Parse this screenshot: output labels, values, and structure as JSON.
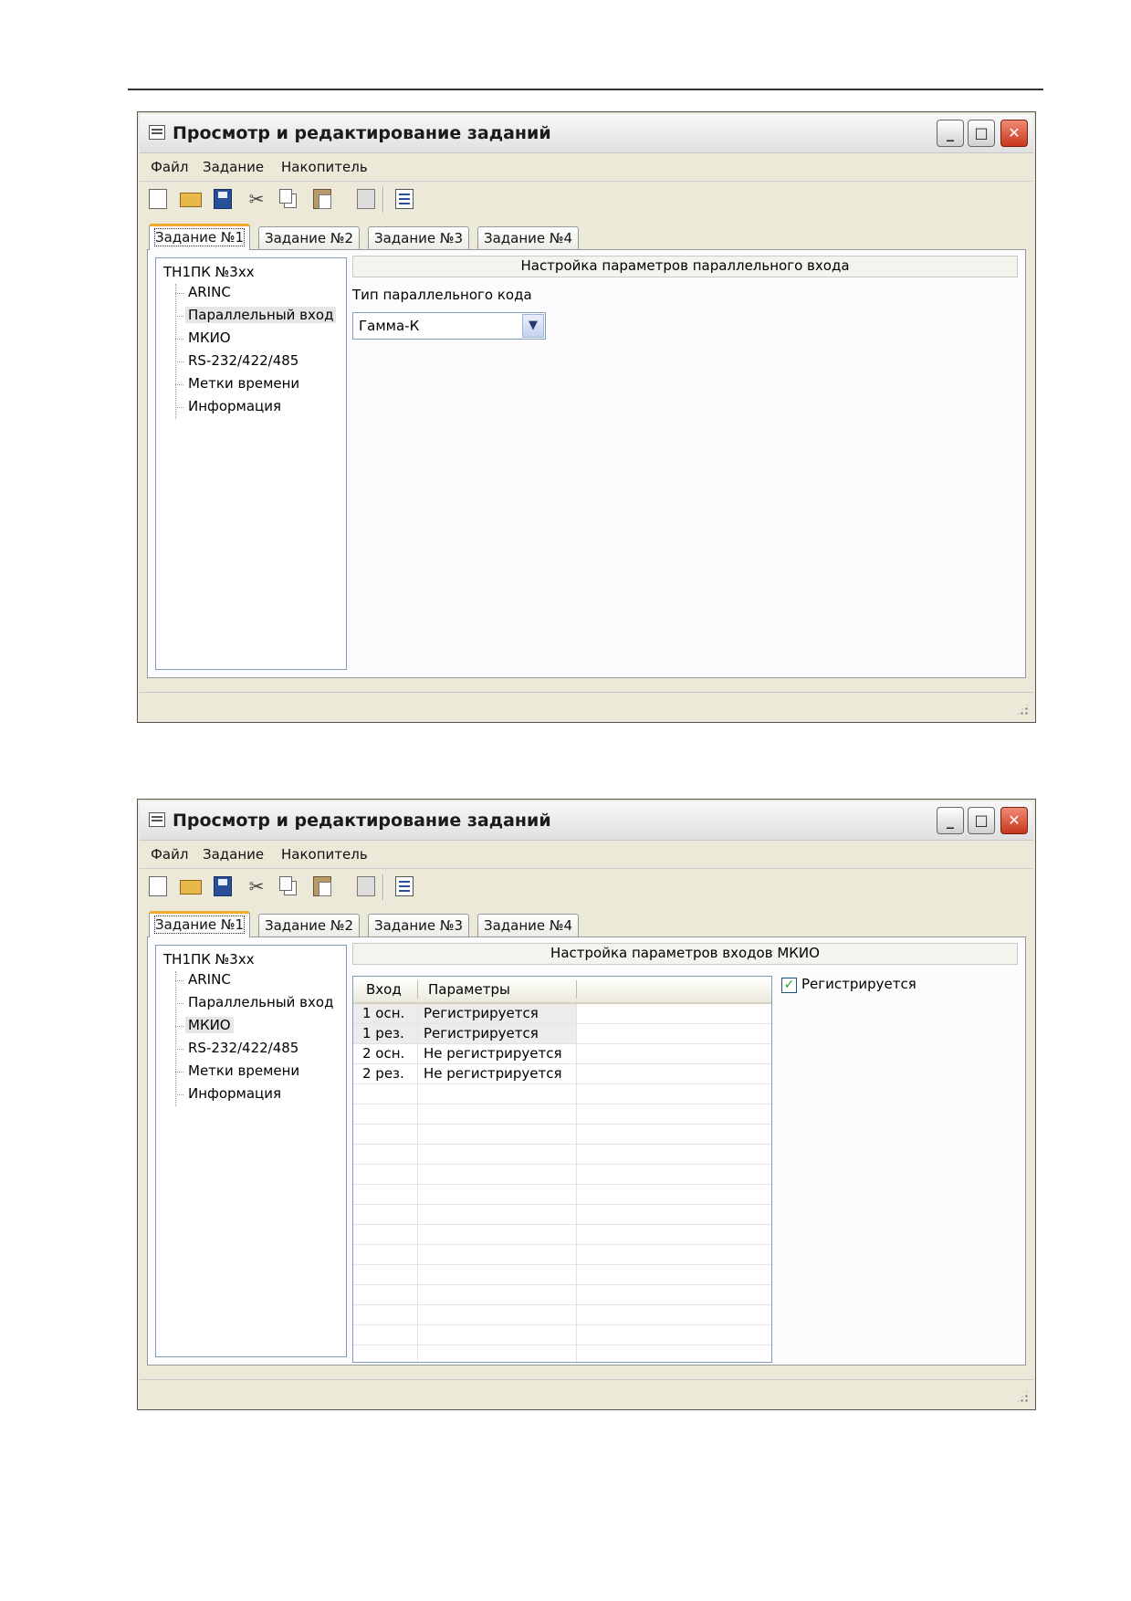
{
  "windows": [
    {
      "title": "Просмотр и редактирование заданий",
      "window_buttons": {
        "minimize": "_",
        "maximize": "□",
        "close": "✕"
      },
      "menu": [
        "Файл",
        "Задание",
        "Накопитель"
      ],
      "toolbar_icons": [
        "new-document-icon",
        "open-folder-icon",
        "save-icon",
        "cut-icon",
        "copy-icon",
        "paste-icon",
        "delete-icon",
        "properties-icon"
      ],
      "tabs": [
        "Задание №1",
        "Задание №2",
        "Задание №3",
        "Задание №4"
      ],
      "active_tab": 0,
      "tree": {
        "root": "ТН1ПК №3xx",
        "items": [
          "ARINC",
          "Параллельный вход",
          "МКИО",
          "RS-232/422/485",
          "Метки времени",
          "Информация"
        ],
        "selected": "Параллельный вход"
      },
      "panel": {
        "header": "Настройка параметров параллельного входа",
        "code_type_label": "Тип параллельного кода",
        "code_type_value": "Гамма-К"
      }
    },
    {
      "title": "Просмотр и редактирование заданий",
      "window_buttons": {
        "minimize": "_",
        "maximize": "□",
        "close": "✕"
      },
      "menu": [
        "Файл",
        "Задание",
        "Накопитель"
      ],
      "toolbar_icons": [
        "new-document-icon",
        "open-folder-icon",
        "save-icon",
        "cut-icon",
        "copy-icon",
        "paste-icon",
        "delete-icon",
        "properties-icon"
      ],
      "tabs": [
        "Задание №1",
        "Задание №2",
        "Задание №3",
        "Задание №4"
      ],
      "active_tab": 0,
      "tree": {
        "root": "ТН1ПК №3xx",
        "items": [
          "ARINC",
          "Параллельный вход",
          "МКИО",
          "RS-232/422/485",
          "Метки времени",
          "Информация"
        ],
        "selected": "МКИО"
      },
      "panel": {
        "header": "Настройка параметров входов МКИО",
        "table": {
          "columns": [
            "Вход",
            "Параметры"
          ],
          "rows": [
            {
              "input": "1 осн.",
              "params": "Регистрируется"
            },
            {
              "input": "1 рез.",
              "params": "Регистрируется"
            },
            {
              "input": "2 осн.",
              "params": "Не регистрируется"
            },
            {
              "input": "2 рез.",
              "params": "Не регистрируется"
            }
          ]
        },
        "checkbox_label": "Регистрируется",
        "checkbox_checked": true,
        "checkbox_mark": "✓"
      }
    }
  ],
  "colors": {
    "active_tab_accent": "#f1a92f",
    "close_button": "#c8361c",
    "checkmark": "#21a121"
  }
}
